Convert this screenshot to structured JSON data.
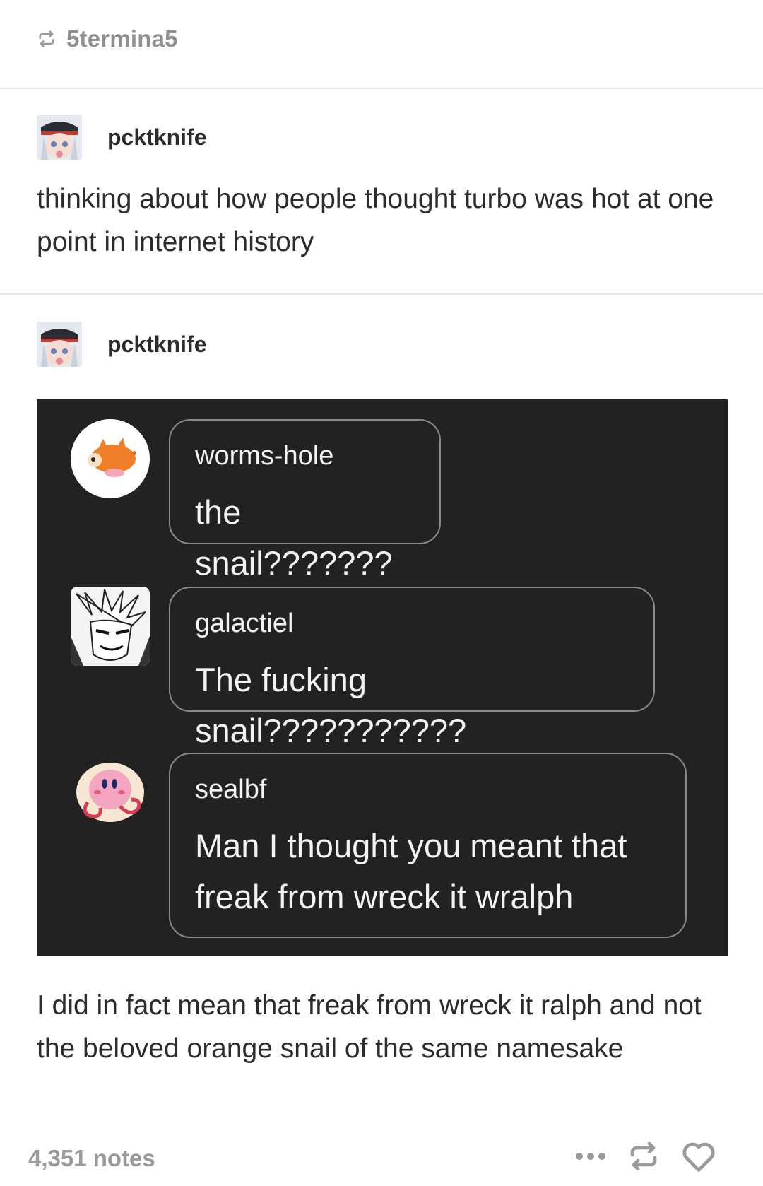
{
  "reblog": {
    "icon": "reblog-icon",
    "username": "5termina5"
  },
  "post1": {
    "username": "pcktknife",
    "avatar": "user-avatar",
    "text": "thinking about how people thought turbo was hot at one point in internet history"
  },
  "post2": {
    "username": "pcktknife",
    "avatar": "user-avatar",
    "messages": [
      {
        "name": "worms-hole",
        "text": "the snail???????",
        "avatar": "orange-creature-avatar"
      },
      {
        "name": "galactiel",
        "text": "The fucking snail???????????",
        "avatar": "manga-character-avatar"
      },
      {
        "name": "sealbf",
        "text": "Man I thought you meant that freak from wreck it wralph",
        "avatar": "kirby-avatar"
      }
    ],
    "text": "I did in fact mean that freak from wreck it ralph and not the beloved orange snail of the same namesake"
  },
  "footer": {
    "notes": "4,351 notes",
    "actions": [
      "more-icon",
      "reblog-icon",
      "heart-icon"
    ]
  },
  "colors": {
    "dark_panel": "#222222",
    "muted": "#9a9a9a",
    "bubble_border": "#8a8a8a"
  }
}
